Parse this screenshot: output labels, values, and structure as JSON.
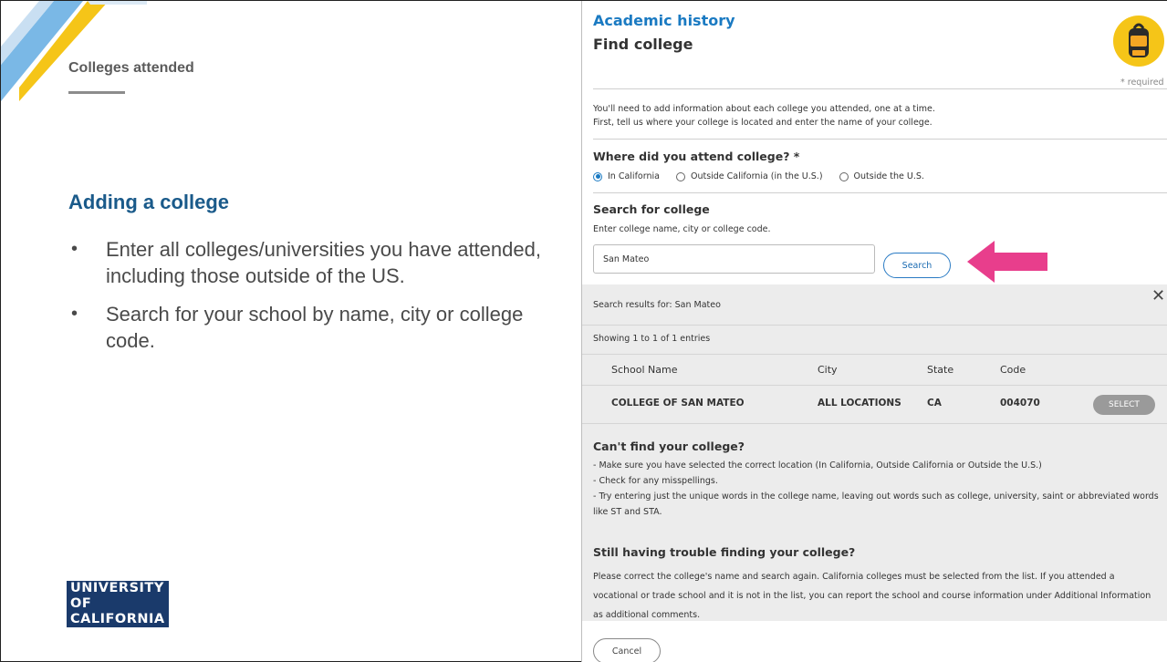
{
  "slide": {
    "section_title": "Colleges attended",
    "heading": "Adding a college",
    "bullets": [
      "Enter all colleges/universities you have attended, including those outside of the US.",
      "Search for your school by name, city or college code."
    ],
    "bullet_glyph": "•",
    "logo_lines": [
      "UNIVERSITY",
      "OF",
      "CALIFORNIA"
    ],
    "arrow_color": "#e83e8c"
  },
  "app": {
    "section": "Academic history",
    "page_title": "Find college",
    "required_note": "* required",
    "intro_lines": [
      "You'll need to add information about each college you attended, one at a time.",
      "First, tell us where your college is located and enter the name of your college."
    ],
    "where_label": "Where did you attend college? *",
    "location_options": [
      {
        "label": "In California",
        "selected": true
      },
      {
        "label": "Outside California (in the U.S.)",
        "selected": false
      },
      {
        "label": "Outside the U.S.",
        "selected": false
      }
    ],
    "search_label": "Search for college",
    "search_hint": "Enter college name, city or college code.",
    "search_value": "San Mateo",
    "search_button": "Search",
    "results": {
      "heading": "Search results for: San Mateo",
      "close_glyph": "✕",
      "showing": "Showing 1 to 1 of 1 entries",
      "columns": [
        "School Name",
        "City",
        "State",
        "Code"
      ],
      "rows": [
        {
          "school": "COLLEGE OF SAN MATEO",
          "city": "ALL LOCATIONS",
          "state": "CA",
          "code": "004070",
          "action": "SELECT"
        }
      ]
    },
    "cant_find_heading": "Can't find your college?",
    "cant_find_tips": [
      "- Make sure you have selected the correct location (In California, Outside California or Outside the U.S.)",
      "- Check for any misspellings.",
      "- Try entering just the unique words in the college name, leaving out words such as college, university, saint or abbreviated words like ST and STA."
    ],
    "still_heading": "Still having trouble finding your college?",
    "still_text": "Please correct the college's name and search again. California colleges must be selected from the list. If you attended a vocational or trade school and it is not in the list, you can report the school and course information under Additional Information as additional comments.",
    "cancel_button": "Cancel",
    "accent_color": "#1a7ac2"
  }
}
